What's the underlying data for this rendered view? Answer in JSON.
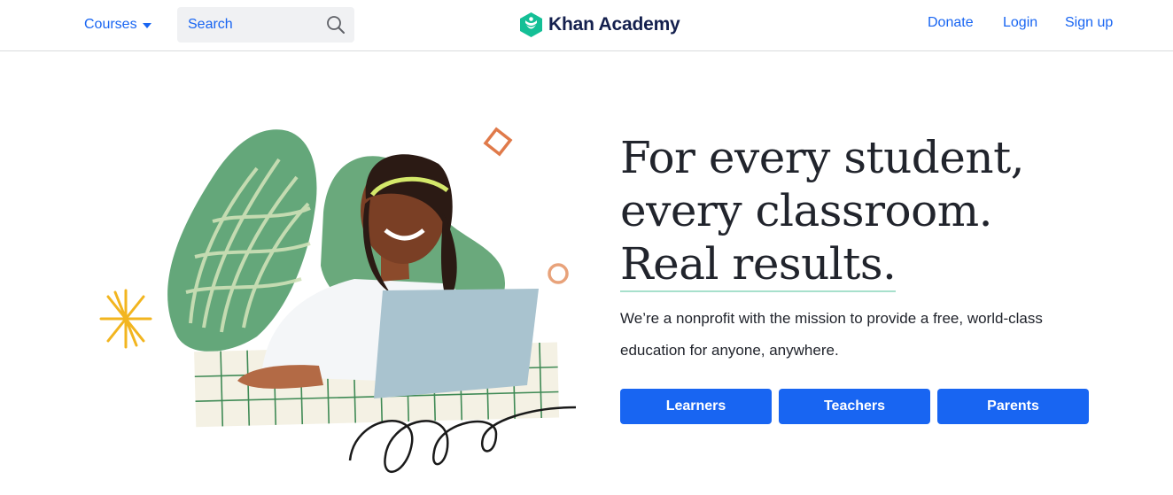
{
  "header": {
    "courses_label": "Courses",
    "search_placeholder": "Search",
    "logo_text": "Khan Academy",
    "donate_label": "Donate",
    "login_label": "Login",
    "signup_label": "Sign up"
  },
  "hero": {
    "headline_line1": "For every student,",
    "headline_line2": "every classroom.",
    "headline_line3": "Real results.",
    "subtext_line1": "We’re a nonprofit with the mission to provide a free, world-class",
    "subtext_line2": "education for anyone, anywhere.",
    "buttons": [
      {
        "label": "Learners"
      },
      {
        "label": "Teachers"
      },
      {
        "label": "Parents"
      }
    ]
  },
  "colors": {
    "brand_blue": "#1865f2",
    "logo_green": "#14bf96",
    "logo_text": "#14204e",
    "heading_text": "#21242c",
    "underline_mint": "#a7e0cc"
  },
  "icons": [
    "chevron-down-icon",
    "search-icon",
    "khan-academy-logo-icon"
  ]
}
